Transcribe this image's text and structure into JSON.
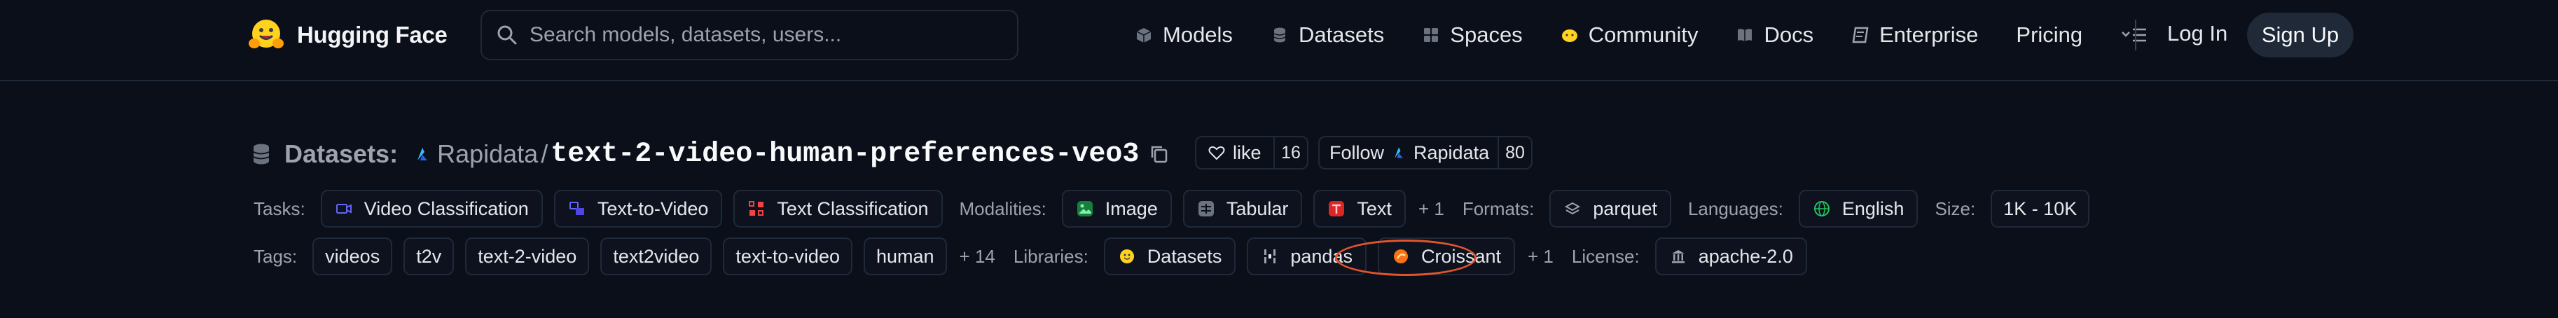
{
  "navbar": {
    "logo_text": "Hugging Face",
    "search_placeholder": "Search models, datasets, users...",
    "links": [
      "Models",
      "Datasets",
      "Spaces",
      "Community",
      "Docs",
      "Enterprise",
      "Pricing"
    ],
    "login": "Log In",
    "signup": "Sign Up"
  },
  "header": {
    "section": "Datasets:",
    "org": "Rapidata",
    "separator": "/",
    "repo": "text-2-video-human-preferences-veo3",
    "like_label": "like",
    "like_count": "16",
    "follow_label": "Follow",
    "follow_org": "Rapidata",
    "follow_count": "80"
  },
  "row1": {
    "tasks_label": "Tasks:",
    "tasks": [
      "Video Classification",
      "Text-to-Video",
      "Text Classification"
    ],
    "modalities_label": "Modalities:",
    "modalities": [
      "Image",
      "Tabular",
      "Text"
    ],
    "modalities_more": "+ 1",
    "formats_label": "Formats:",
    "format": "parquet",
    "languages_label": "Languages:",
    "language": "English",
    "size_label": "Size:",
    "size": "1K - 10K"
  },
  "row2": {
    "tags_label": "Tags:",
    "tags": [
      "videos",
      "t2v",
      "text-2-video",
      "text2video",
      "text-to-video",
      "human"
    ],
    "tags_more": "+ 14",
    "libraries_label": "Libraries:",
    "libraries": [
      "Datasets",
      "pandas",
      "Croissant"
    ],
    "libraries_more": "+ 1",
    "license_label": "License:",
    "license": "apache-2.0"
  },
  "annotation": {
    "highlight_color": "#e2552b",
    "highlighted_item": "Croissant"
  },
  "colors": {
    "background": "#0b0f19",
    "border": "#1f2937",
    "muted_text": "#9ca3af",
    "text": "#e5e7eb"
  }
}
